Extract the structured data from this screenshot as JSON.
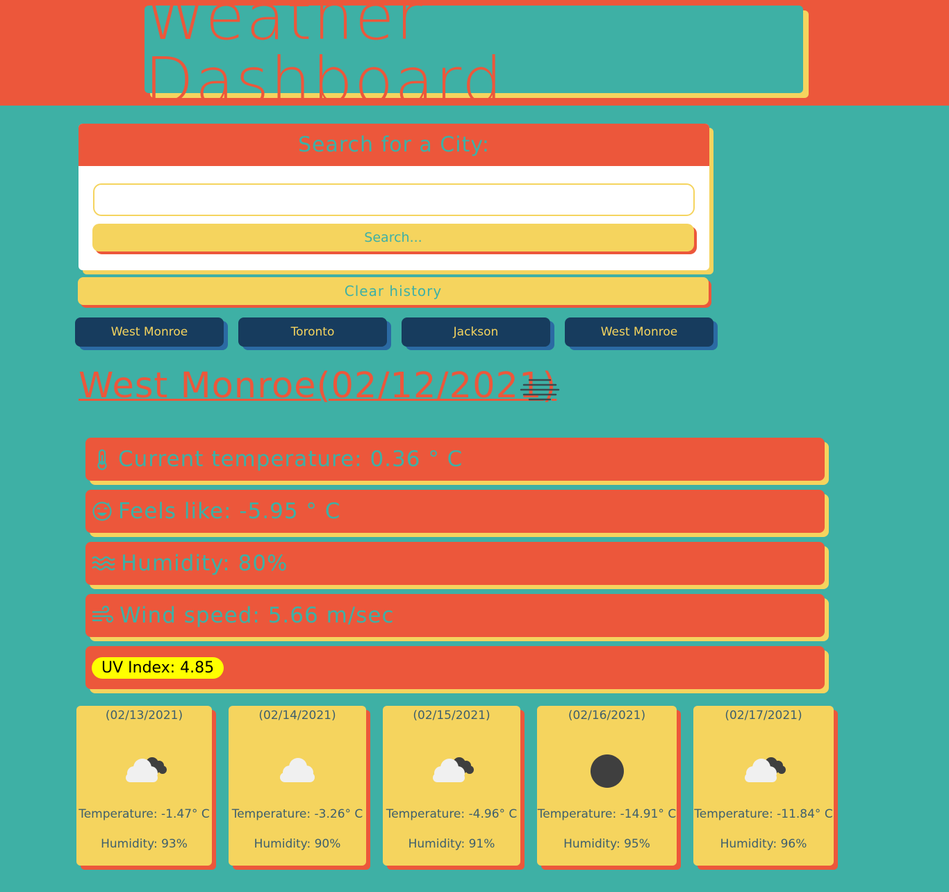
{
  "header": {
    "title": "Weather Dashboard"
  },
  "search": {
    "heading": "Search for a City:",
    "input_value": "",
    "input_placeholder": "",
    "button_label": "Search..."
  },
  "clear_history_label": "Clear history",
  "history": [
    "West Monroe",
    "Toronto",
    "Jackson",
    "West Monroe"
  ],
  "current": {
    "city": "West Monroe",
    "date": "(02/12/2021)",
    "weather_icon": "mist-icon",
    "temperature_text": "Current temperature: 0.36 ° C",
    "feels_like_text": "Feels like: -5.95 ° C",
    "humidity_text": "Humidity: 80%",
    "wind_text": "Wind speed: 5.66 m/sec",
    "uv_text": "UV Index: 4.85",
    "icons": {
      "temperature": "thermometer-icon",
      "feels_like": "smile-sweat-icon",
      "humidity": "water-waves-icon",
      "wind": "wind-icon"
    }
  },
  "forecast": [
    {
      "date": "(02/13/2021)",
      "icon": "partly-cloudy-night-icon",
      "temp": "Temperature: -1.47° C",
      "humidity": "Humidity: 93%"
    },
    {
      "date": "(02/14/2021)",
      "icon": "cloud-icon",
      "temp": "Temperature: -3.26° C",
      "humidity": "Humidity: 90%"
    },
    {
      "date": "(02/15/2021)",
      "icon": "partly-cloudy-night-icon",
      "temp": "Temperature: -4.96° C",
      "humidity": "Humidity: 91%"
    },
    {
      "date": "(02/16/2021)",
      "icon": "clear-night-icon",
      "temp": "Temperature: -14.91° C",
      "humidity": "Humidity: 95%"
    },
    {
      "date": "(02/17/2021)",
      "icon": "partly-cloudy-night-icon",
      "temp": "Temperature: -11.84° C",
      "humidity": "Humidity: 96%"
    }
  ],
  "colors": {
    "background": "#3eb0a5",
    "accent_red": "#ec573b",
    "accent_yellow": "#f5d45e",
    "history_button": "#173c5e",
    "uv_badge": "#ffff00"
  }
}
